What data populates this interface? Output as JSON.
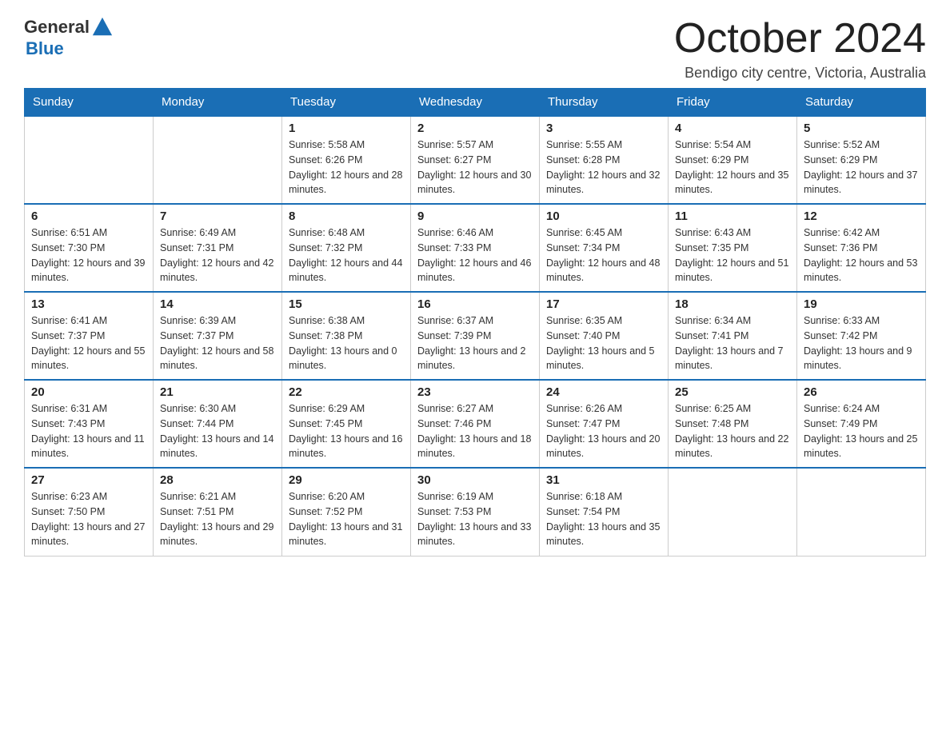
{
  "logo": {
    "general": "General",
    "blue": "Blue"
  },
  "title": "October 2024",
  "location": "Bendigo city centre, Victoria, Australia",
  "days_of_week": [
    "Sunday",
    "Monday",
    "Tuesday",
    "Wednesday",
    "Thursday",
    "Friday",
    "Saturday"
  ],
  "weeks": [
    [
      {
        "day": "",
        "sunrise": "",
        "sunset": "",
        "daylight": ""
      },
      {
        "day": "",
        "sunrise": "",
        "sunset": "",
        "daylight": ""
      },
      {
        "day": "1",
        "sunrise": "Sunrise: 5:58 AM",
        "sunset": "Sunset: 6:26 PM",
        "daylight": "Daylight: 12 hours and 28 minutes."
      },
      {
        "day": "2",
        "sunrise": "Sunrise: 5:57 AM",
        "sunset": "Sunset: 6:27 PM",
        "daylight": "Daylight: 12 hours and 30 minutes."
      },
      {
        "day": "3",
        "sunrise": "Sunrise: 5:55 AM",
        "sunset": "Sunset: 6:28 PM",
        "daylight": "Daylight: 12 hours and 32 minutes."
      },
      {
        "day": "4",
        "sunrise": "Sunrise: 5:54 AM",
        "sunset": "Sunset: 6:29 PM",
        "daylight": "Daylight: 12 hours and 35 minutes."
      },
      {
        "day": "5",
        "sunrise": "Sunrise: 5:52 AM",
        "sunset": "Sunset: 6:29 PM",
        "daylight": "Daylight: 12 hours and 37 minutes."
      }
    ],
    [
      {
        "day": "6",
        "sunrise": "Sunrise: 6:51 AM",
        "sunset": "Sunset: 7:30 PM",
        "daylight": "Daylight: 12 hours and 39 minutes."
      },
      {
        "day": "7",
        "sunrise": "Sunrise: 6:49 AM",
        "sunset": "Sunset: 7:31 PM",
        "daylight": "Daylight: 12 hours and 42 minutes."
      },
      {
        "day": "8",
        "sunrise": "Sunrise: 6:48 AM",
        "sunset": "Sunset: 7:32 PM",
        "daylight": "Daylight: 12 hours and 44 minutes."
      },
      {
        "day": "9",
        "sunrise": "Sunrise: 6:46 AM",
        "sunset": "Sunset: 7:33 PM",
        "daylight": "Daylight: 12 hours and 46 minutes."
      },
      {
        "day": "10",
        "sunrise": "Sunrise: 6:45 AM",
        "sunset": "Sunset: 7:34 PM",
        "daylight": "Daylight: 12 hours and 48 minutes."
      },
      {
        "day": "11",
        "sunrise": "Sunrise: 6:43 AM",
        "sunset": "Sunset: 7:35 PM",
        "daylight": "Daylight: 12 hours and 51 minutes."
      },
      {
        "day": "12",
        "sunrise": "Sunrise: 6:42 AM",
        "sunset": "Sunset: 7:36 PM",
        "daylight": "Daylight: 12 hours and 53 minutes."
      }
    ],
    [
      {
        "day": "13",
        "sunrise": "Sunrise: 6:41 AM",
        "sunset": "Sunset: 7:37 PM",
        "daylight": "Daylight: 12 hours and 55 minutes."
      },
      {
        "day": "14",
        "sunrise": "Sunrise: 6:39 AM",
        "sunset": "Sunset: 7:37 PM",
        "daylight": "Daylight: 12 hours and 58 minutes."
      },
      {
        "day": "15",
        "sunrise": "Sunrise: 6:38 AM",
        "sunset": "Sunset: 7:38 PM",
        "daylight": "Daylight: 13 hours and 0 minutes."
      },
      {
        "day": "16",
        "sunrise": "Sunrise: 6:37 AM",
        "sunset": "Sunset: 7:39 PM",
        "daylight": "Daylight: 13 hours and 2 minutes."
      },
      {
        "day": "17",
        "sunrise": "Sunrise: 6:35 AM",
        "sunset": "Sunset: 7:40 PM",
        "daylight": "Daylight: 13 hours and 5 minutes."
      },
      {
        "day": "18",
        "sunrise": "Sunrise: 6:34 AM",
        "sunset": "Sunset: 7:41 PM",
        "daylight": "Daylight: 13 hours and 7 minutes."
      },
      {
        "day": "19",
        "sunrise": "Sunrise: 6:33 AM",
        "sunset": "Sunset: 7:42 PM",
        "daylight": "Daylight: 13 hours and 9 minutes."
      }
    ],
    [
      {
        "day": "20",
        "sunrise": "Sunrise: 6:31 AM",
        "sunset": "Sunset: 7:43 PM",
        "daylight": "Daylight: 13 hours and 11 minutes."
      },
      {
        "day": "21",
        "sunrise": "Sunrise: 6:30 AM",
        "sunset": "Sunset: 7:44 PM",
        "daylight": "Daylight: 13 hours and 14 minutes."
      },
      {
        "day": "22",
        "sunrise": "Sunrise: 6:29 AM",
        "sunset": "Sunset: 7:45 PM",
        "daylight": "Daylight: 13 hours and 16 minutes."
      },
      {
        "day": "23",
        "sunrise": "Sunrise: 6:27 AM",
        "sunset": "Sunset: 7:46 PM",
        "daylight": "Daylight: 13 hours and 18 minutes."
      },
      {
        "day": "24",
        "sunrise": "Sunrise: 6:26 AM",
        "sunset": "Sunset: 7:47 PM",
        "daylight": "Daylight: 13 hours and 20 minutes."
      },
      {
        "day": "25",
        "sunrise": "Sunrise: 6:25 AM",
        "sunset": "Sunset: 7:48 PM",
        "daylight": "Daylight: 13 hours and 22 minutes."
      },
      {
        "day": "26",
        "sunrise": "Sunrise: 6:24 AM",
        "sunset": "Sunset: 7:49 PM",
        "daylight": "Daylight: 13 hours and 25 minutes."
      }
    ],
    [
      {
        "day": "27",
        "sunrise": "Sunrise: 6:23 AM",
        "sunset": "Sunset: 7:50 PM",
        "daylight": "Daylight: 13 hours and 27 minutes."
      },
      {
        "day": "28",
        "sunrise": "Sunrise: 6:21 AM",
        "sunset": "Sunset: 7:51 PM",
        "daylight": "Daylight: 13 hours and 29 minutes."
      },
      {
        "day": "29",
        "sunrise": "Sunrise: 6:20 AM",
        "sunset": "Sunset: 7:52 PM",
        "daylight": "Daylight: 13 hours and 31 minutes."
      },
      {
        "day": "30",
        "sunrise": "Sunrise: 6:19 AM",
        "sunset": "Sunset: 7:53 PM",
        "daylight": "Daylight: 13 hours and 33 minutes."
      },
      {
        "day": "31",
        "sunrise": "Sunrise: 6:18 AM",
        "sunset": "Sunset: 7:54 PM",
        "daylight": "Daylight: 13 hours and 35 minutes."
      },
      {
        "day": "",
        "sunrise": "",
        "sunset": "",
        "daylight": ""
      },
      {
        "day": "",
        "sunrise": "",
        "sunset": "",
        "daylight": ""
      }
    ]
  ]
}
